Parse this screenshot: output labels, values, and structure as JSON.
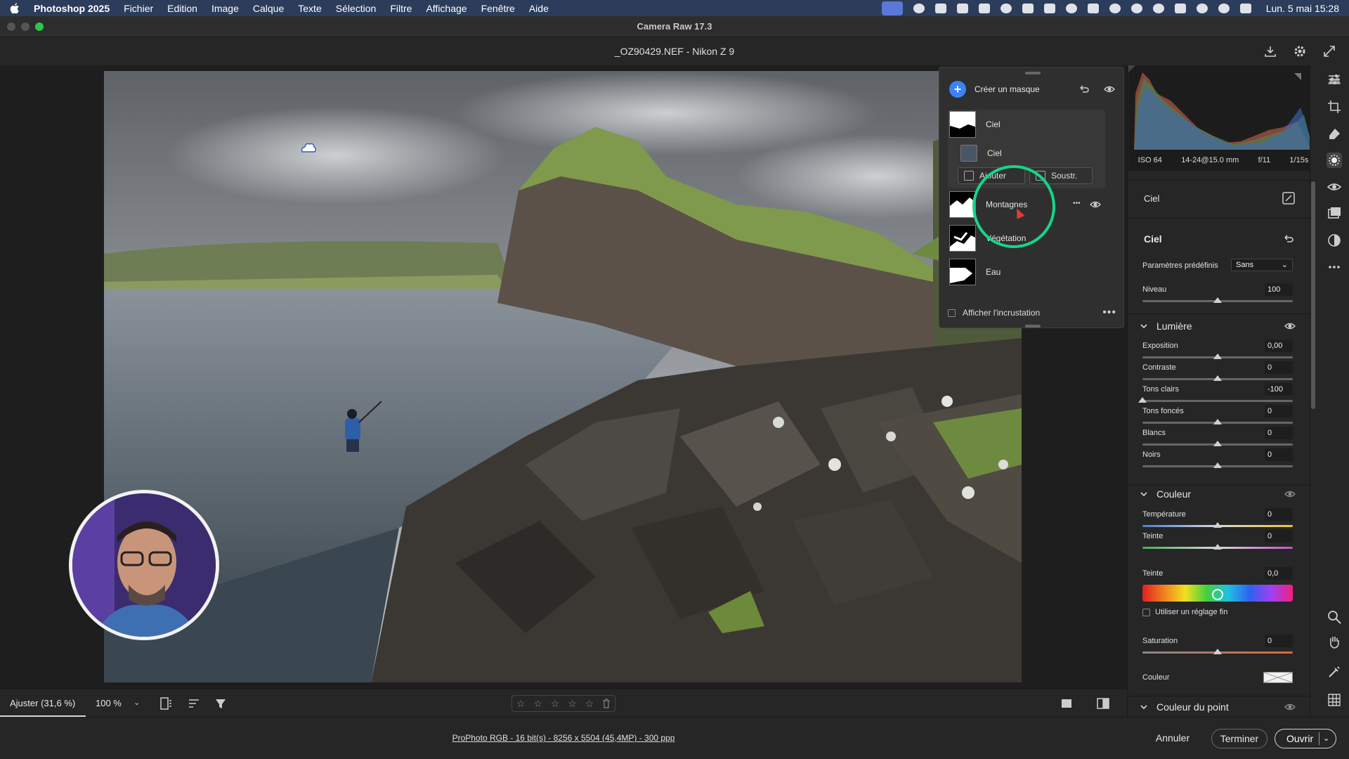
{
  "menubar": {
    "app_name": "Photoshop 2025",
    "items": [
      "Fichier",
      "Edition",
      "Image",
      "Calque",
      "Texte",
      "Sélection",
      "Filtre",
      "Affichage",
      "Fenêtre",
      "Aide"
    ],
    "clock": "Lun. 5 mai  15:28"
  },
  "window": {
    "title": "Camera Raw 17.3"
  },
  "file": {
    "header": "_OZ90429.NEF  -  Nikon Z 9"
  },
  "mask_panel": {
    "create_label": "Créer un masque",
    "masks": [
      {
        "name": "Ciel",
        "sub_name": "Ciel"
      },
      {
        "name": "Montagnes"
      },
      {
        "name": "Végétation"
      },
      {
        "name": "Eau"
      }
    ],
    "add_label": "Ajouter",
    "subtract_label": "Soustr.",
    "overlay_label": "Afficher l'incrustation",
    "more_icon": "•••",
    "row_more_icon": "•••"
  },
  "histogram": {
    "exif": [
      "ISO 64",
      "14-24@15.0 mm",
      "f/11",
      "1/15s"
    ]
  },
  "adjust_panel": {
    "mask_title": "Ciel",
    "section_title": "Ciel",
    "preset_label": "Paramètres prédéfinis",
    "preset_value": "Sans",
    "level_label": "Niveau",
    "level_value": "100",
    "level_fraction": 0.5,
    "light": {
      "title": "Lumière",
      "sliders": [
        {
          "label": "Exposition",
          "value": "0,00",
          "pos": 0.5
        },
        {
          "label": "Contraste",
          "value": "0",
          "pos": 0.5
        },
        {
          "label": "Tons clairs",
          "value": "-100",
          "pos": 0.0
        },
        {
          "label": "Tons foncés",
          "value": "0",
          "pos": 0.5
        },
        {
          "label": "Blancs",
          "value": "0",
          "pos": 0.5
        },
        {
          "label": "Noirs",
          "value": "0",
          "pos": 0.5
        }
      ]
    },
    "color": {
      "title": "Couleur",
      "temperature_label": "Température",
      "temperature_value": "0",
      "temperature_pos": 0.5,
      "tint_label": "Teinte",
      "tint_value": "0",
      "tint_pos": 0.5,
      "hue_label": "Teinte",
      "hue_value": "0,0",
      "hue_pos": 0.5,
      "fine_label": "Utiliser un réglage fin",
      "saturation_label": "Saturation",
      "saturation_value": "0",
      "saturation_pos": 0.5,
      "color_label": "Couleur"
    },
    "point_color_title": "Couleur du point"
  },
  "bottom_bar": {
    "fit_label": "Ajuster (31,6 %)",
    "zoom_label": "100 %",
    "stars": [
      "☆",
      "☆",
      "☆",
      "☆",
      "☆"
    ]
  },
  "status_bar": {
    "workflow": "ProPhoto RGB - 16 bit(s) - 8256 x 5504 (45,4MP) - 300 ppp",
    "cancel_label": "Annuler",
    "done_label": "Terminer",
    "open_label": "Ouvrir"
  },
  "colors": {
    "accent": "#3b82f6",
    "highlight": "#16d58a",
    "menubar": "#2b3d5b"
  }
}
